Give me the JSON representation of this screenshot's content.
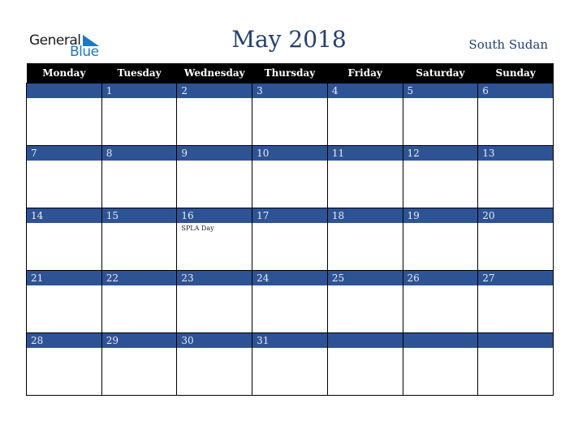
{
  "logo": {
    "line1": "General",
    "line2": "Blue"
  },
  "title": "May 2018",
  "country": "South Sudan",
  "weekdays": [
    "Monday",
    "Tuesday",
    "Wednesday",
    "Thursday",
    "Friday",
    "Saturday",
    "Sunday"
  ],
  "weeks": [
    [
      {
        "d": ""
      },
      {
        "d": "1"
      },
      {
        "d": "2"
      },
      {
        "d": "3"
      },
      {
        "d": "4"
      },
      {
        "d": "5"
      },
      {
        "d": "6"
      }
    ],
    [
      {
        "d": "7"
      },
      {
        "d": "8"
      },
      {
        "d": "9"
      },
      {
        "d": "10"
      },
      {
        "d": "11"
      },
      {
        "d": "12"
      },
      {
        "d": "13"
      }
    ],
    [
      {
        "d": "14"
      },
      {
        "d": "15"
      },
      {
        "d": "16",
        "e": "SPLA Day"
      },
      {
        "d": "17"
      },
      {
        "d": "18"
      },
      {
        "d": "19"
      },
      {
        "d": "20"
      }
    ],
    [
      {
        "d": "21"
      },
      {
        "d": "22"
      },
      {
        "d": "23"
      },
      {
        "d": "24"
      },
      {
        "d": "25"
      },
      {
        "d": "26"
      },
      {
        "d": "27"
      }
    ],
    [
      {
        "d": "28"
      },
      {
        "d": "29"
      },
      {
        "d": "30"
      },
      {
        "d": "31"
      },
      {
        "d": ""
      },
      {
        "d": ""
      },
      {
        "d": ""
      }
    ]
  ],
  "colors": {
    "accent": "#2e5395",
    "title": "#24406e",
    "header_bg": "#000000",
    "logo_blue": "#1f78c1"
  }
}
